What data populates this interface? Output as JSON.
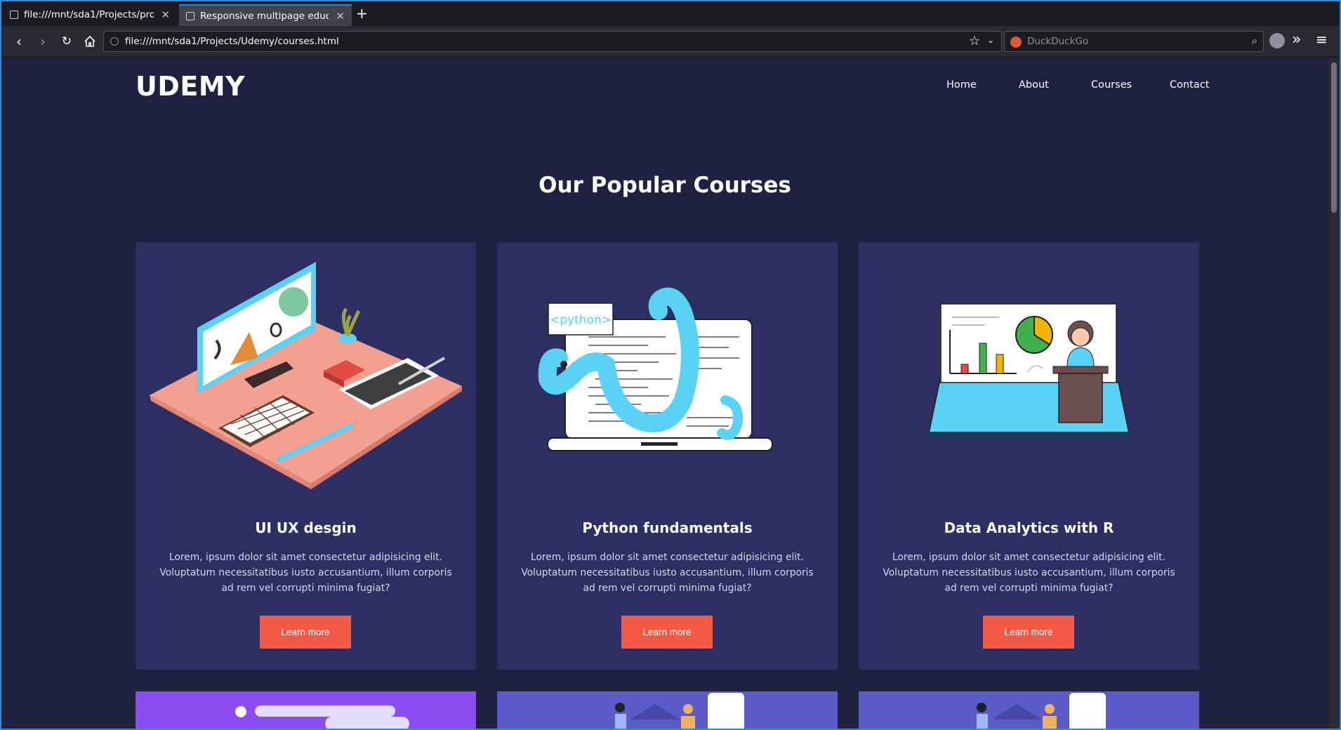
{
  "browser": {
    "tabs": [
      {
        "title": "file:///mnt/sda1/Projects/proj/..."
      },
      {
        "title": "Responsive multipage educati..."
      }
    ],
    "url": "file:///mnt/sda1/Projects/Udemy/courses.html",
    "search_placeholder": "DuckDuckGo"
  },
  "site": {
    "logo": "UDEMY",
    "nav": [
      "Home",
      "About",
      "Courses",
      "Contact"
    ],
    "heading": "Our Popular Courses",
    "courses": [
      {
        "title": "UI UX desgin",
        "description": "Lorem, ipsum dolor sit amet consectetur adipisicing elit. Voluptatum necessitatibus iusto accusantium, illum corporis ad rem vel corrupti minima fugiat?",
        "button": "Learn more"
      },
      {
        "title": "Python fundamentals",
        "description": "Lorem, ipsum dolor sit amet consectetur adipisicing elit. Voluptatum necessitatibus iusto accusantium, illum corporis ad rem vel corrupti minima fugiat?",
        "button": "Learn more",
        "illustration_label": "<python>"
      },
      {
        "title": "Data Analytics with R",
        "description": "Lorem, ipsum dolor sit amet consectetur adipisicing elit. Voluptatum necessitatibus iusto accusantium, illum corporis ad rem vel corrupti minima fugiat?",
        "button": "Learn more"
      }
    ]
  },
  "colors": {
    "page_bg": "#1f2140",
    "card_bg": "#2d2f63",
    "button": "#f25a45",
    "accent_blue": "#2a8fd6"
  }
}
